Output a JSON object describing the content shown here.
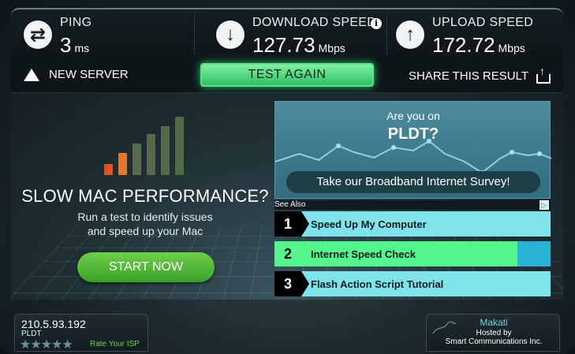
{
  "stats": {
    "ping": {
      "label": "PING",
      "value": "3",
      "unit": "ms",
      "icon": "ping-arrows-icon"
    },
    "download": {
      "label": "DOWNLOAD SPEED",
      "value": "127.73",
      "unit": "Mbps",
      "icon": "download-arrow-icon",
      "info_icon": "info-icon"
    },
    "upload": {
      "label": "UPLOAD SPEED",
      "value": "172.72",
      "unit": "Mbps",
      "icon": "upload-arrow-icon"
    }
  },
  "actions": {
    "new_server": "NEW SERVER",
    "test_again": "TEST AGAIN",
    "share": "SHARE THIS RESULT"
  },
  "ad_left": {
    "headline": "SLOW MAC PERFORMANCE?",
    "sub_line1": "Run a test to identify issues",
    "sub_line2": "and speed up your Mac",
    "cta": "START NOW"
  },
  "ad_pldt": {
    "question_line1": "Are you on",
    "question_line2": "PLDT?",
    "survey": "Take our Broadband Internet Survey!"
  },
  "see_also": {
    "title": "See Also",
    "links": [
      {
        "num": "1",
        "text": "Speed Up My Computer"
      },
      {
        "num": "2",
        "text": "Internet Speed Check"
      },
      {
        "num": "3",
        "text": "Flash Action Script Tutorial"
      }
    ]
  },
  "bottom_left": {
    "ip": "210.5.93.192",
    "isp": "PLDT",
    "stars": "★★★★★",
    "rate": "Rate Your ISP"
  },
  "bottom_right": {
    "location": "Makati",
    "hosted_by": "Hosted by",
    "host": "Smart Communications Inc."
  },
  "colors": {
    "accent_green": "#53f58d",
    "link_bg": "#7ee3ea",
    "bar_orange": "#e0621e"
  }
}
